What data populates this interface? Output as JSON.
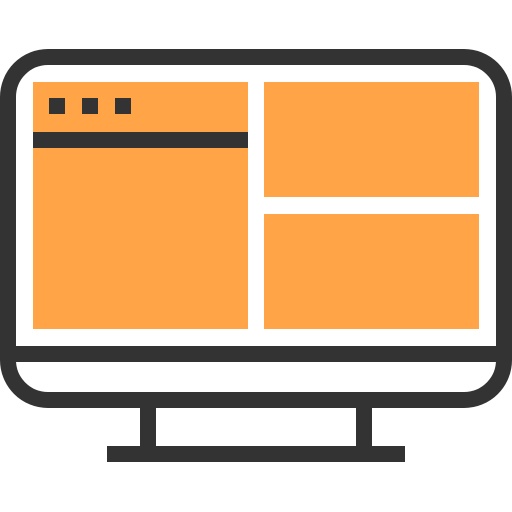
{
  "icon": {
    "name": "desktop-monitor-icon",
    "colors": {
      "outline": "#333333",
      "panel_fill": "#FFA447",
      "screen_bg": "#FFFFFF"
    },
    "window_dots": 3
  }
}
